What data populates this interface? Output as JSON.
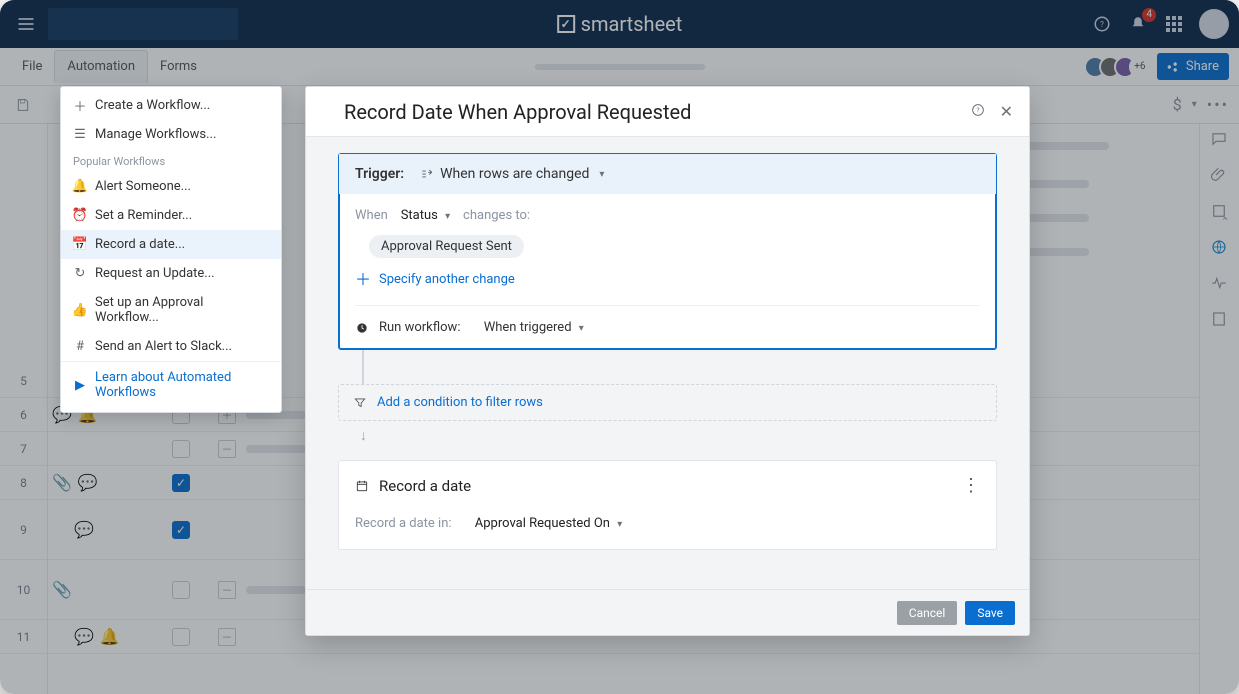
{
  "brand": "smartsheet",
  "notifications_count": "4",
  "menubar": {
    "file": "File",
    "automation": "Automation",
    "forms": "Forms"
  },
  "presence_more": "+6",
  "share_label": "Share",
  "dropdown": {
    "create": "Create a Workflow...",
    "manage": "Manage Workflows...",
    "section": "Popular Workflows",
    "alert": "Alert Someone...",
    "reminder": "Set a Reminder...",
    "record": "Record a date...",
    "request": "Request an Update...",
    "approval": "Set up an Approval Workflow...",
    "slack": "Send an Alert to Slack...",
    "learn": "Learn about Automated Workflows"
  },
  "rows": [
    "5",
    "6",
    "7",
    "8",
    "9",
    "10",
    "11"
  ],
  "modal": {
    "title": "Record Date When Approval Requested",
    "trigger_label": "Trigger:",
    "trigger_value": "When rows are changed",
    "when_label": "When",
    "when_field": "Status",
    "changes_to": "changes to:",
    "chip_value": "Approval Request Sent",
    "specify_more": "Specify another change",
    "run_label": "Run workflow:",
    "run_value": "When triggered",
    "condition": "Add a condition to filter rows",
    "action_title": "Record a date",
    "record_in_label": "Record a date in:",
    "record_in_value": "Approval Requested On",
    "cancel": "Cancel",
    "save": "Save"
  }
}
